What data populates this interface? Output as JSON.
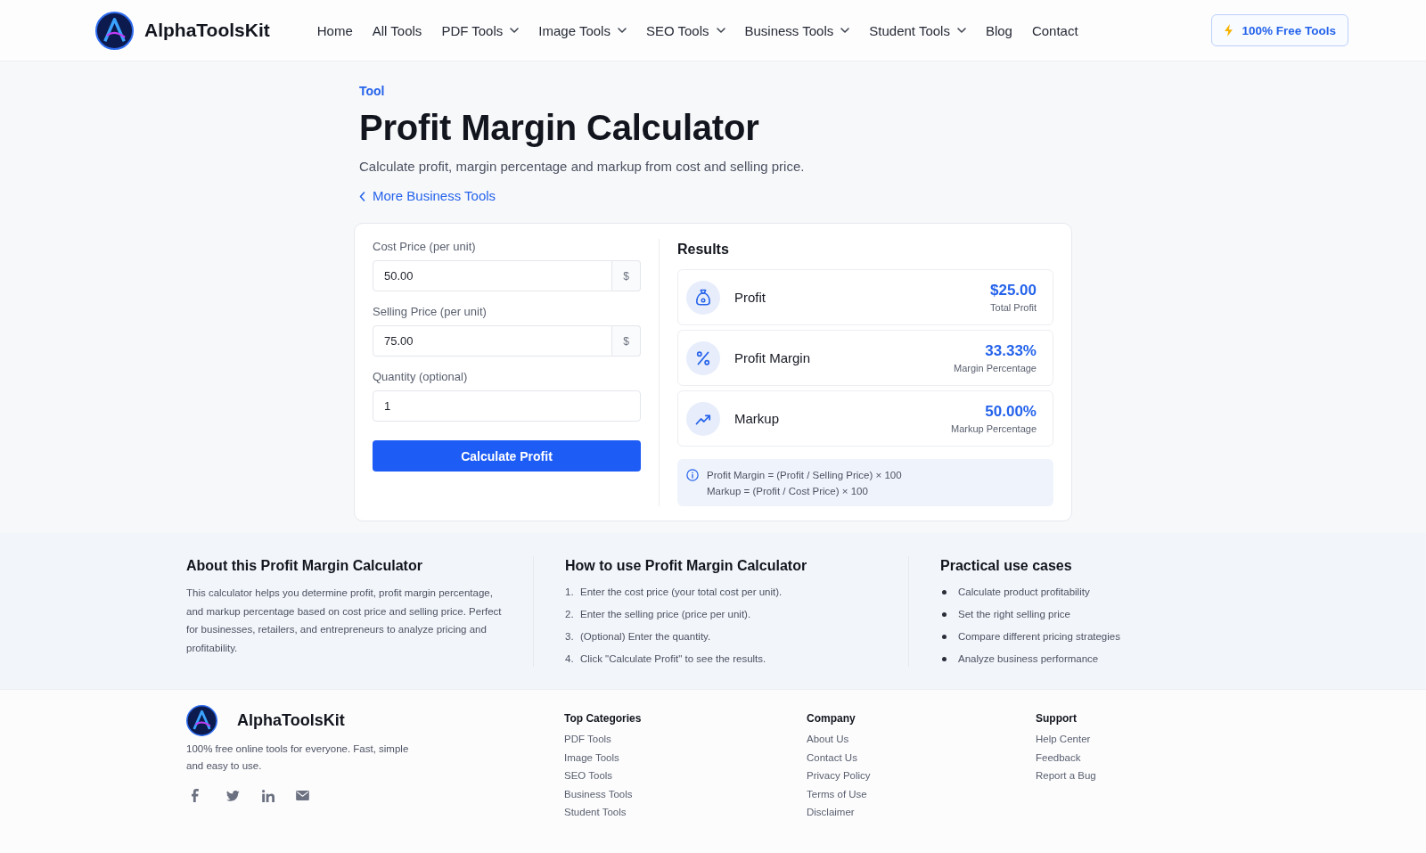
{
  "header": {
    "brand": "AlphaToolsKit",
    "nav": [
      {
        "label": "Home",
        "has_menu": false
      },
      {
        "label": "All Tools",
        "has_menu": false
      },
      {
        "label": "PDF Tools",
        "has_menu": true
      },
      {
        "label": "Image Tools",
        "has_menu": true
      },
      {
        "label": "SEO Tools",
        "has_menu": true
      },
      {
        "label": "Business Tools",
        "has_menu": true
      },
      {
        "label": "Student Tools",
        "has_menu": true
      },
      {
        "label": "Blog",
        "has_menu": false
      },
      {
        "label": "Contact",
        "has_menu": false
      }
    ],
    "cta": "100% Free Tools"
  },
  "hero": {
    "eyebrow": "Tool",
    "title": "Profit Margin Calculator",
    "subtitle": "Calculate profit, margin percentage and markup from cost and selling price.",
    "back_link": "More Business Tools"
  },
  "calculator": {
    "fields": [
      {
        "label": "Cost Price (per unit)",
        "value": "50.00",
        "suffix": "$"
      },
      {
        "label": "Selling Price (per unit)",
        "value": "75.00",
        "suffix": "$"
      },
      {
        "label": "Quantity (optional)",
        "value": "1"
      }
    ],
    "button": "Calculate Profit"
  },
  "results": {
    "title": "Results",
    "items": [
      {
        "kind": "profit",
        "label": "Profit",
        "value": "$25.00",
        "caption": "Total Profit"
      },
      {
        "kind": "margin",
        "label": "Profit Margin",
        "value": "33.33%",
        "caption": "Margin Percentage"
      },
      {
        "kind": "markup",
        "label": "Markup",
        "value": "50.00%",
        "caption": "Markup Percentage"
      }
    ],
    "formulas": [
      "Profit Margin = (Profit / Selling Price) × 100",
      "Markup = (Profit / Cost Price) × 100"
    ]
  },
  "about": {
    "title": "About this Profit Margin Calculator",
    "text": "This calculator helps you determine profit, profit margin percentage, and markup percentage based on cost price and selling price. Perfect for businesses, retailers, and entrepreneurs to analyze pricing and profitability."
  },
  "how_to": {
    "title": "How to use Profit Margin Calculator",
    "steps": [
      {
        "number": "1.",
        "text": "Enter the cost price (your total cost per unit)."
      },
      {
        "number": "2.",
        "text": "Enter the selling price (price per unit)."
      },
      {
        "number": "3.",
        "text": "(Optional) Enter the quantity."
      },
      {
        "number": "4.",
        "text": "Click \"Calculate Profit\" to see the results."
      }
    ]
  },
  "use_cases": {
    "title": "Practical use cases",
    "items": [
      "Calculate product profitability",
      "Set the right selling price",
      "Compare different pricing strategies",
      "Analyze business performance"
    ]
  },
  "footer": {
    "brand": "AlphaToolsKit",
    "tagline": "100% free online tools for everyone. Fast, simple and easy to use.",
    "columns": [
      {
        "title": "Top Categories",
        "links": [
          "PDF Tools",
          "Image Tools",
          "SEO Tools",
          "Business Tools",
          "Student Tools"
        ]
      },
      {
        "title": "Company",
        "links": [
          "About Us",
          "Contact Us",
          "Privacy Policy",
          "Terms of Use",
          "Disclaimer"
        ]
      },
      {
        "title": "Support",
        "links": [
          "Help Center",
          "Feedback",
          "Report a Bug"
        ]
      }
    ]
  }
}
